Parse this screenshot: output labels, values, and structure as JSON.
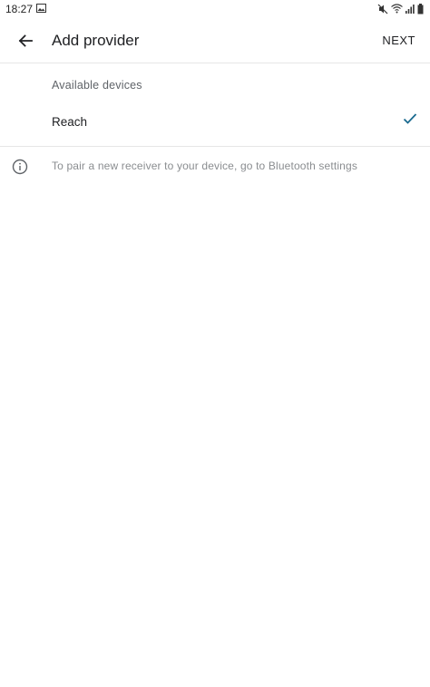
{
  "status_bar": {
    "time": "18:27"
  },
  "header": {
    "title": "Add provider",
    "next_label": "NEXT"
  },
  "section": {
    "label": "Available devices"
  },
  "devices": [
    {
      "name": "Reach",
      "selected": true
    }
  ],
  "info": {
    "text": "To pair a new receiver to your device, go to Bluetooth settings"
  },
  "colors": {
    "accent": "#1a6a8f",
    "text": "#202124",
    "muted": "#8a8d90"
  }
}
